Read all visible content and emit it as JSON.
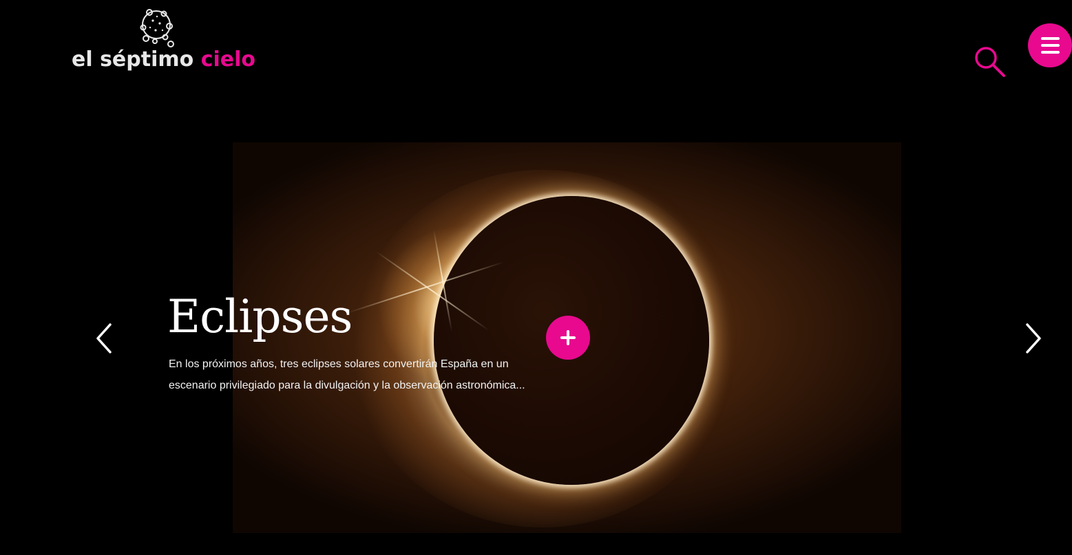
{
  "brand": {
    "word1": "el séptimo",
    "word2": "cielo",
    "accent_color": "#e8098f"
  },
  "header": {
    "search_icon": "search-icon",
    "menu_icon": "hamburger-menu-icon"
  },
  "slider": {
    "title": "Eclipses",
    "description": "En los próximos años, tres eclipses solares convertirán España en un escenario privilegiado para la divulgación y la observación astronómica...",
    "prev_icon": "chevron-left-icon",
    "next_icon": "chevron-right-icon",
    "more_icon": "plus-icon",
    "image_subject": "solar-eclipse-image"
  }
}
